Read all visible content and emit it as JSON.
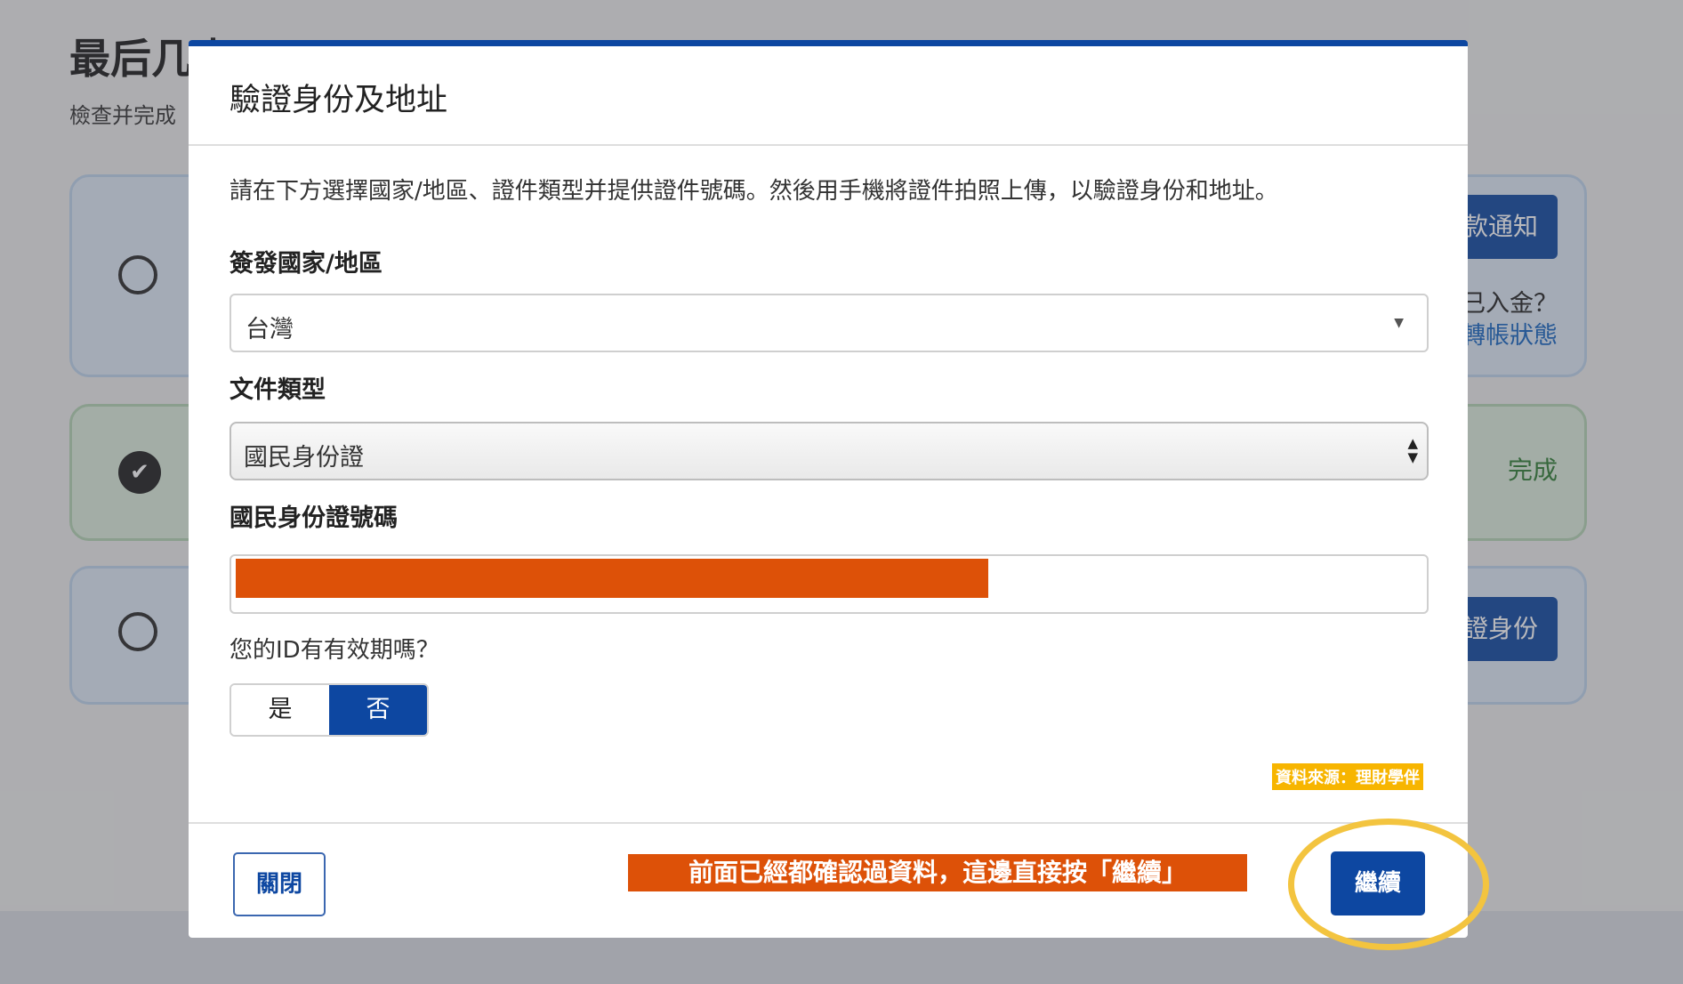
{
  "background": {
    "title": "最后几步",
    "subtitle": "檢查并完成",
    "card1": {
      "button_label": "款通知",
      "note_line1": "已入金？",
      "note_line2": "轉帳狀態"
    },
    "card2": {
      "status": "完成"
    },
    "card3": {
      "button_label": "證身份"
    }
  },
  "modal": {
    "title": "驗證身份及地址",
    "instruction": "請在下方選擇國家/地區、證件類型并提供證件號碼。然後用手機將證件拍照上傳，以驗證身份和地址。",
    "country_label": "簽發國家/地區",
    "country_value": "台灣",
    "doc_type_label": "文件類型",
    "doc_type_value": "國民身份證",
    "id_number_label": "國民身份證號碼",
    "expiry_question": "您的ID有有效期嗎？",
    "expiry_options": [
      "是",
      "否"
    ],
    "expiry_selected": "否",
    "close_label": "關閉",
    "continue_label": "繼續"
  },
  "overlay": {
    "source_credit": "資料來源：理財學伴",
    "annotation": "前面已經都確認過資料，這邊直接按「繼續」"
  },
  "colors": {
    "primary": "#0d47a1",
    "annotation_bg": "#dd5108",
    "highlight_ring": "#f3c43f",
    "credit_bg": "#f7b500"
  }
}
